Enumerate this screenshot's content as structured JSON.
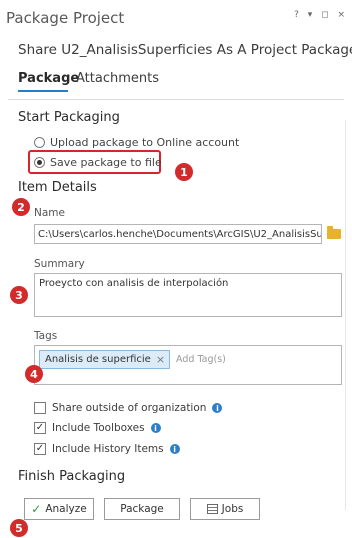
{
  "pane": {
    "title": "Package Project",
    "controls": "? ▾ ◻ ×",
    "subtitle": "Share U2_AnalisisSuperficies As A Project Package"
  },
  "tabs": [
    {
      "label": "Package",
      "active": true
    },
    {
      "label": "Attachments",
      "active": false
    }
  ],
  "start_packaging": {
    "heading": "Start Packaging",
    "options": [
      {
        "label": "Upload package to Online account",
        "selected": false
      },
      {
        "label": "Save package to file",
        "selected": true
      }
    ]
  },
  "item_details": {
    "heading": "Item Details",
    "name_label": "Name",
    "name_value": "C:\\Users\\carlos.henche\\Documents\\ArcGIS\\U2_AnalisisSup",
    "summary_label": "Summary",
    "summary_value": "Proeycto con analisis de interpolación",
    "tags_label": "Tags",
    "tags": [
      "Analisis de superficie"
    ],
    "add_tag_placeholder": "Add Tag(s)",
    "checkboxes": [
      {
        "label": "Share outside of organization",
        "checked": false,
        "info": true
      },
      {
        "label": "Include Toolboxes",
        "checked": true,
        "info": true
      },
      {
        "label": "Include History Items",
        "checked": true,
        "info": true
      }
    ]
  },
  "finish_packaging": {
    "heading": "Finish Packaging",
    "buttons": {
      "analyze": "Analyze",
      "package": "Package",
      "jobs": "Jobs"
    }
  },
  "annotations": [
    "1",
    "2",
    "3",
    "4",
    "5"
  ],
  "colors": {
    "annotation_red": "#d12b2b",
    "accent_blue": "#2a7cc7",
    "tag_bg": "#dcebf8"
  }
}
